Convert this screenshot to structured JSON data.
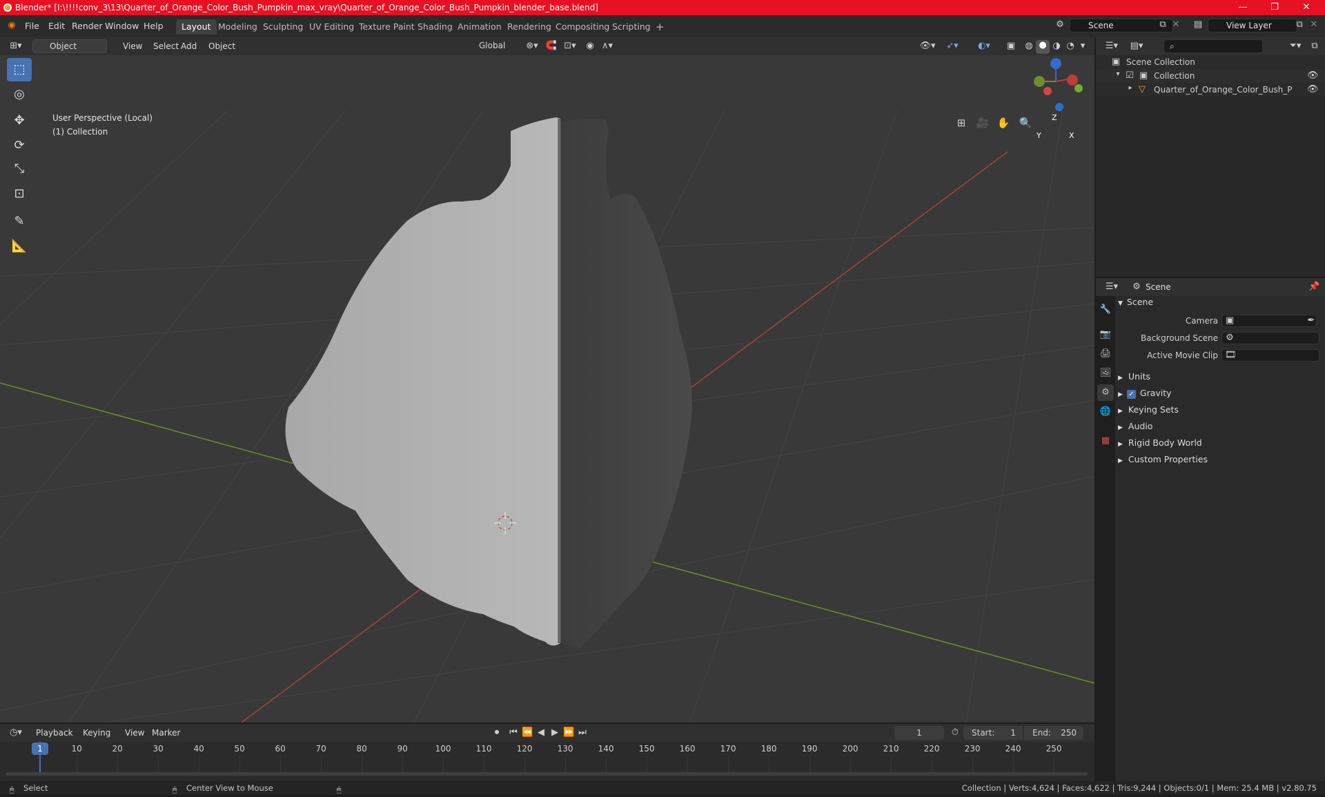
{
  "window": {
    "title": "Blender* [I:\\!!!!conv_3\\13\\Quarter_of_Orange_Color_Bush_Pumpkin_max_vray\\Quarter_of_Orange_Color_Bush_Pumpkin_blender_base.blend]",
    "controls": {
      "minimize": "—",
      "maximize": "❐",
      "close": "✕"
    }
  },
  "menu": {
    "items": [
      "File",
      "Edit",
      "Render",
      "Window",
      "Help"
    ],
    "workspaces": [
      "Layout",
      "Modeling",
      "Sculpting",
      "UV Editing",
      "Texture Paint",
      "Shading",
      "Animation",
      "Rendering",
      "Compositing",
      "Scripting"
    ],
    "active_workspace": "Layout",
    "add_tab": "+",
    "scene_name": "Scene",
    "view_layer": "View Layer"
  },
  "viewport_header": {
    "mode": "Object Mode",
    "menus": [
      "View",
      "Select",
      "Add",
      "Object"
    ],
    "transform_orientation": "Global"
  },
  "viewport": {
    "overlay_line1": "User Perspective (Local)",
    "overlay_line2": "(1) Collection",
    "gizmo": {
      "z": "Z",
      "y": "Y",
      "x": "X"
    },
    "colors": {
      "x_axis": "#b5423f",
      "y_axis": "#6d8f2a",
      "select_active": "#4772b3"
    }
  },
  "toolbar": {
    "tools": [
      "select-box",
      "cursor",
      "move",
      "rotate",
      "scale",
      "transform",
      "annotate",
      "measure"
    ]
  },
  "outliner": {
    "root": "Scene Collection",
    "collection": "Collection",
    "object": "Quarter_of_Orange_Color_Bush_Pumpkin_pi"
  },
  "properties": {
    "context": "Scene",
    "panel_title": "Scene",
    "fields": [
      {
        "label": "Camera"
      },
      {
        "label": "Background Scene"
      },
      {
        "label": "Active Movie Clip"
      }
    ],
    "sections": [
      "Units",
      "Gravity",
      "Keying Sets",
      "Audio",
      "Rigid Body World",
      "Custom Properties"
    ],
    "gravity_checked": true
  },
  "timeline": {
    "menus": [
      "Playback",
      "Keying",
      "View",
      "Marker"
    ],
    "current_frame": "1",
    "start_label": "Start:",
    "start": "1",
    "end_label": "End:",
    "end": "250",
    "ticks": [
      "1",
      "10",
      "20",
      "30",
      "40",
      "50",
      "60",
      "70",
      "80",
      "90",
      "100",
      "110",
      "120",
      "130",
      "140",
      "150",
      "160",
      "170",
      "180",
      "190",
      "200",
      "210",
      "220",
      "230",
      "240",
      "250"
    ]
  },
  "status": {
    "left": "Select",
    "middle": "Center View to Mouse",
    "right": "Collection | Verts:4,624 | Faces:4,622 | Tris:9,244 | Objects:0/1 | Mem: 25.4 MB | v2.80.75"
  }
}
